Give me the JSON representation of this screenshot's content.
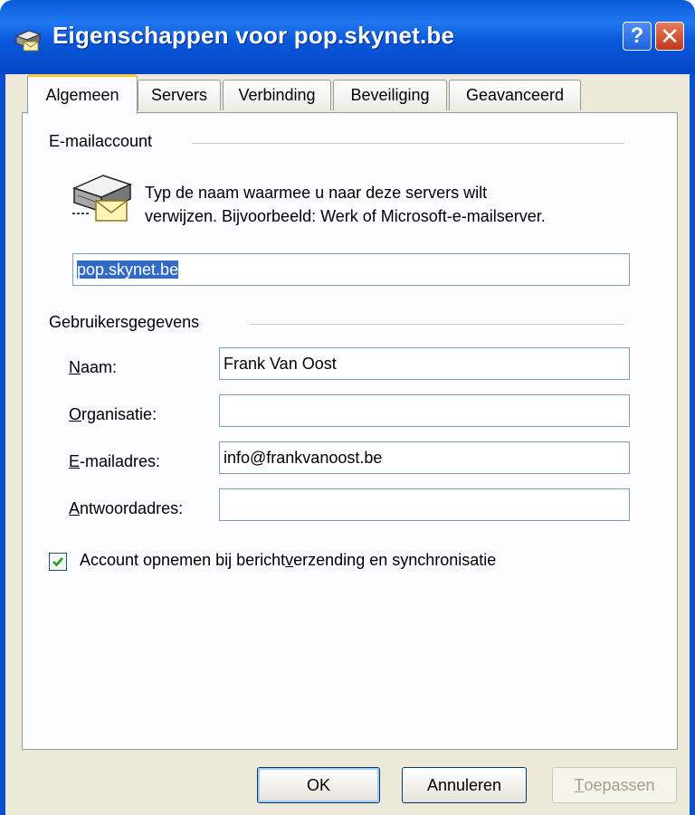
{
  "window": {
    "title": "Eigenschappen voor pop.skynet.be",
    "help_glyph": "?",
    "close_glyph": "✕"
  },
  "tabs": [
    {
      "label": "Algemeen",
      "active": true
    },
    {
      "label": "Servers",
      "active": false
    },
    {
      "label": "Verbinding",
      "active": false
    },
    {
      "label": "Beveiliging",
      "active": false
    },
    {
      "label": "Geavanceerd",
      "active": false
    }
  ],
  "email_account": {
    "group_label": "E-mailaccount",
    "description_line1": "Typ de naam waarmee u naar deze servers wilt",
    "description_line2": "verwijzen. Bijvoorbeeld: Werk of Microsoft-e-mailserver.",
    "account_name_value": "pop.skynet.be"
  },
  "user_info": {
    "group_label": "Gebruikersgegevens",
    "name_label": {
      "mnemonic": "N",
      "rest": "aam:"
    },
    "name_value": "Frank Van Oost",
    "org_label": {
      "mnemonic": "O",
      "rest": "rganisatie:"
    },
    "org_value": "",
    "email_label": {
      "mnemonic": "E",
      "rest": "-mailadres:"
    },
    "email_value": "info@frankvanoost.be",
    "reply_label": {
      "mnemonic": "A",
      "rest": "ntwoordadres:"
    },
    "reply_value": ""
  },
  "include_account": {
    "checked": true,
    "label_before": "Account opnemen bij bericht",
    "label_mnemonic": "v",
    "label_after": "erzending en synchronisatie"
  },
  "buttons": {
    "ok": "OK",
    "cancel": "Annuleren",
    "apply_mnemonic": "T",
    "apply_rest": "oepassen"
  },
  "colors": {
    "titlebar": "#0a58dc",
    "dialog_bg": "#ece9d8",
    "active_tab_highlight": "#ffc83c",
    "checkmark": "#21a121",
    "selection": "#316ac5"
  },
  "icons": {
    "title": "mail-server-icon",
    "account": "mail-server-envelope-icon",
    "checkbox": "checkmark-icon"
  }
}
